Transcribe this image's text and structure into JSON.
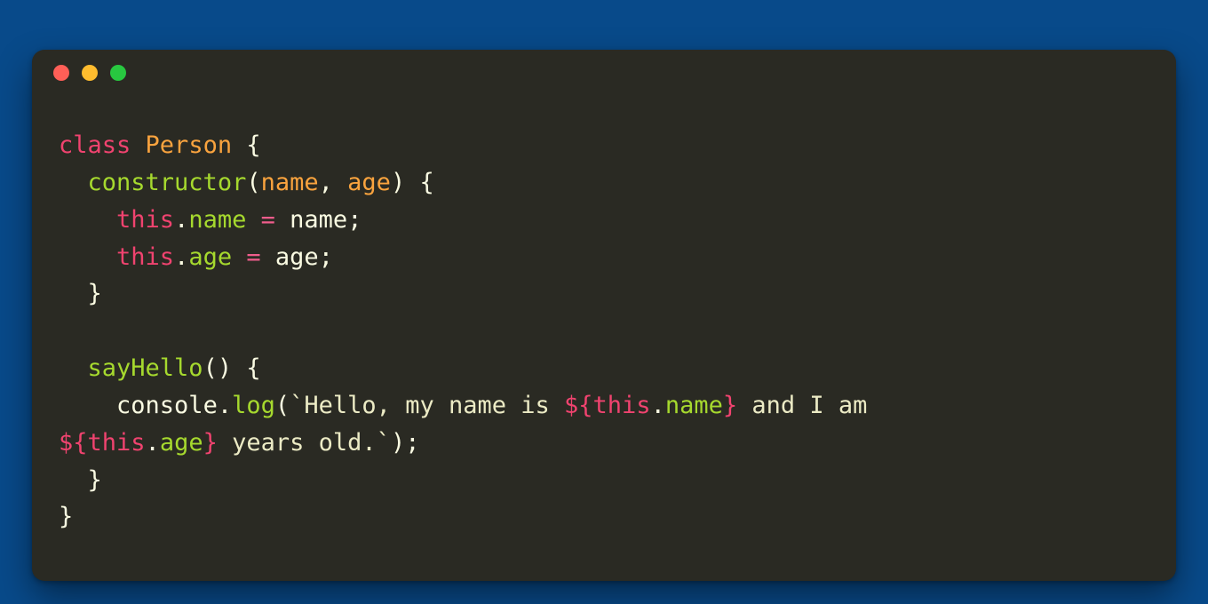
{
  "window": {
    "traffic_lights": {
      "red": "#ff5f57",
      "yellow": "#febc2e",
      "green": "#28c840"
    },
    "bg": "#2a2a23"
  },
  "code": {
    "kw_class": "class",
    "class_name": "Person",
    "brace_open": "{",
    "fn_constructor": "constructor",
    "paren_open": "(",
    "param_name": "name",
    "comma": ",",
    "param_age": "age",
    "paren_close": ")",
    "kw_this": "this",
    "dot": ".",
    "prop_name": "name",
    "op_assign": "=",
    "id_name": "name",
    "semi": ";",
    "prop_age": "age",
    "id_age": "age",
    "brace_close": "}",
    "fn_sayHello": "sayHello",
    "empty_parens": "()",
    "id_console": "console",
    "fn_log": "log",
    "tpl_open": "`",
    "str_part1": "Hello, my name is ",
    "interp_open": "${",
    "interp_close": "}",
    "str_part2": " and I am ",
    "str_part3": " years old.",
    "tpl_close": "`",
    "indent1": "  ",
    "indent2": "    "
  }
}
